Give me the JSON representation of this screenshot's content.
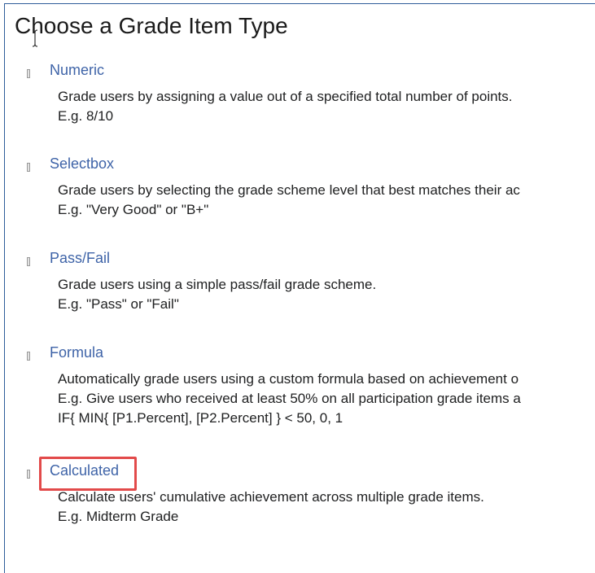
{
  "page": {
    "title": "Choose a Grade Item Type"
  },
  "grade_types": [
    {
      "name": "Numeric",
      "lines": [
        "Grade users by assigning a value out of a specified total number of points.",
        "E.g. 8/10"
      ]
    },
    {
      "name": "Selectbox",
      "lines": [
        "Grade users by selecting the grade scheme level that best matches their ac",
        "E.g. \"Very Good\" or \"B+\""
      ]
    },
    {
      "name": "Pass/Fail",
      "lines": [
        "Grade users using a simple pass/fail grade scheme.",
        "E.g. \"Pass\" or \"Fail\""
      ]
    },
    {
      "name": "Formula",
      "lines": [
        "Automatically grade users using a custom formula based on achievement o",
        "E.g. Give users who received at least 50% on all participation grade items a",
        "IF{ MIN{ [P1.Percent], [P2.Percent] } < 50, 0, 1"
      ]
    },
    {
      "name": "Calculated",
      "lines": [
        "Calculate users' cumulative achievement across multiple grade items.",
        "E.g. Midterm Grade"
      ]
    }
  ],
  "colors": {
    "link": "#3f64a8",
    "highlight": "#e24a4a",
    "frame": "#2f5d9a",
    "handle": "#9a9a9a"
  },
  "icons": {
    "handle": "drag-handle-icon",
    "cursor": "text-cursor-icon"
  }
}
